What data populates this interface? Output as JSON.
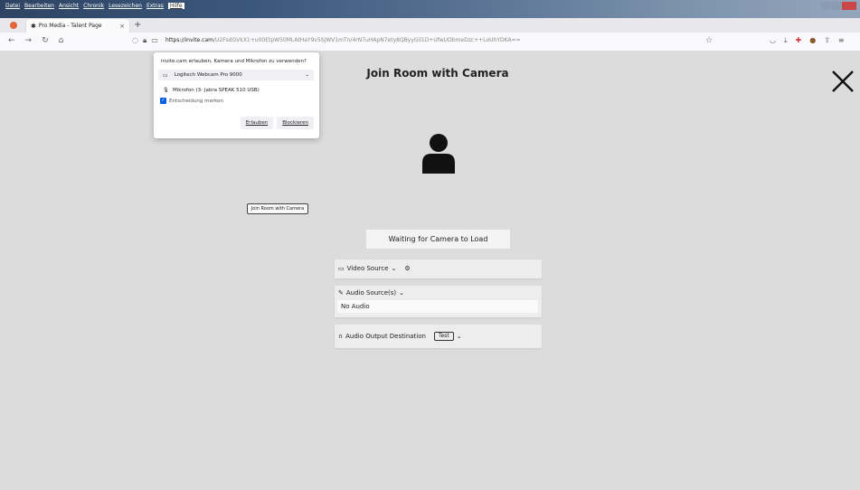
{
  "menubar": [
    "Datei",
    "Bearbeiten",
    "Ansicht",
    "Chronik",
    "Lesezeichen",
    "Extras",
    "Hilfe"
  ],
  "tab": {
    "title": "Pro Media - Talent Page"
  },
  "address": {
    "domain": "https://invite.cam",
    "path": "/U2FsdGVkX1+u00EtpW50MLAtHaY9v5SjWV1mTn/4rN7uHApN7ety8QByyGil1D+UfwUObmeDzc++LoUhYDKA=="
  },
  "permission": {
    "question": "invite.cam erlauben, Kamera und Mikrofon zu verwenden?",
    "camera_device": "Logitech Webcam Pro 9000",
    "microphone_device": "Mikrofon (3- Jabra SPEAK 510 USB)",
    "remember_label": "Entscheidung merken",
    "allow_label": "Erlauben",
    "block_label": "Blockieren"
  },
  "page": {
    "title": "Join Room with Camera",
    "small_button": "Join Room with Camera",
    "waiting": "Waiting for Camera to Load",
    "video_source_label": "Video Source",
    "audio_source_label": "Audio Source(s)",
    "audio_value": "No Audio",
    "audio_output_label": "Audio Output Destination",
    "test_label": "Test"
  }
}
